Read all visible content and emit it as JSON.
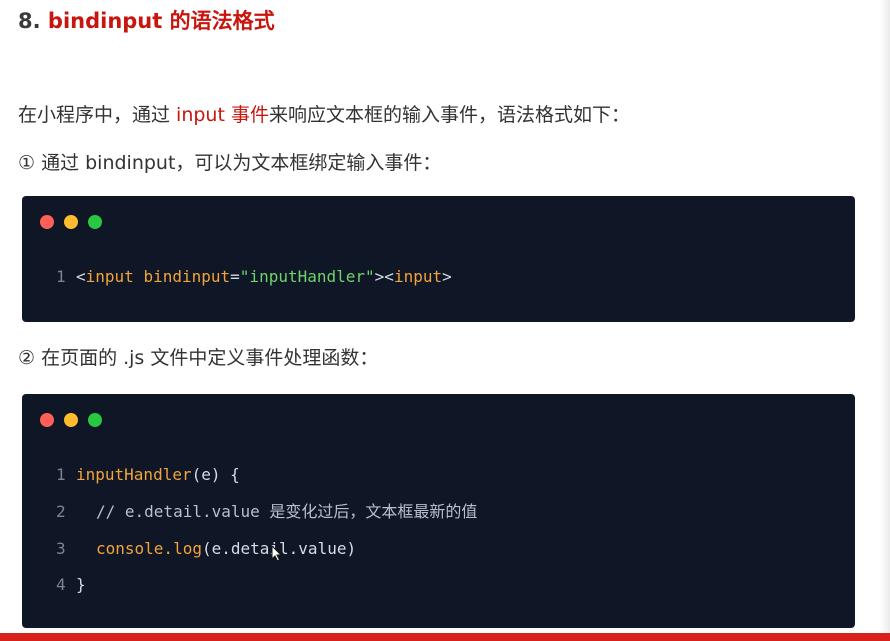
{
  "heading": {
    "number": "8.",
    "text": "bindinput 的语法格式"
  },
  "paragraphs": {
    "intro_prefix": "在小程序中，通过 ",
    "intro_highlight": "input 事件",
    "intro_suffix": "来响应文本框的输入事件，语法格式如下：",
    "step1": "①  通过 bindinput，可以为文本框绑定输入事件：",
    "step2": "②  在页面的 .js 文件中定义事件处理函数："
  },
  "code_block_1": {
    "lines": [
      {
        "number": "1",
        "tokens": {
          "tag_open": "<input",
          "space": " ",
          "attr": "bindinput",
          "eq": "=",
          "value": "\"inputHandler\"",
          "close1": ">",
          "tag2": "<input",
          "close2": ">"
        }
      }
    ]
  },
  "code_block_2": {
    "lines": [
      {
        "number": "1",
        "fn": "inputHandler",
        "rest": "(e) {"
      },
      {
        "number": "2",
        "comment": "// e.detail.value 是变化过后，文本框最新的值"
      },
      {
        "number": "3",
        "fn": "console.log",
        "rest": "(e.detail.value)"
      },
      {
        "number": "4",
        "rest": "}"
      }
    ]
  },
  "colors": {
    "accent_red": "#c8160f",
    "code_background": "#0f1626",
    "keyword_orange": "#f2a33a",
    "string_green": "#6fd36a",
    "window_dot_red": "#ff5f57",
    "window_dot_yellow": "#febc2e",
    "window_dot_green": "#28c840"
  },
  "icons": {
    "cursor": "mouse-pointer-icon"
  }
}
